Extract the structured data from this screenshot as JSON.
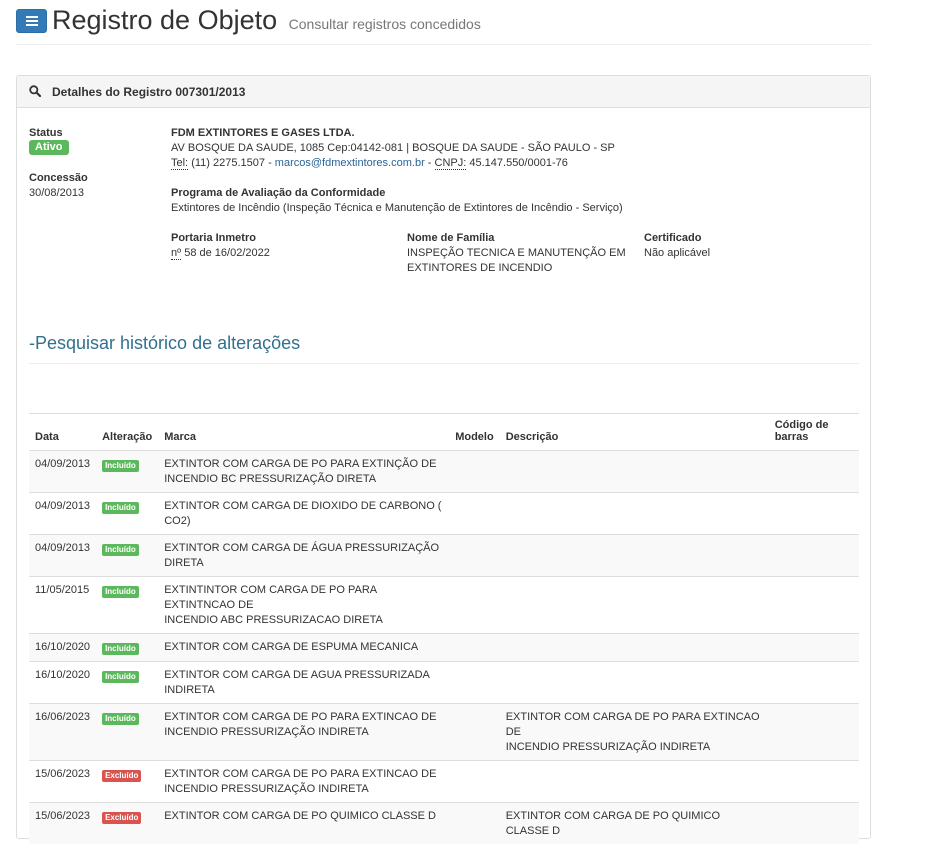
{
  "header": {
    "title": "Registro de Objeto",
    "subtitle": "Consultar registros concedidos"
  },
  "panel": {
    "title": "Detalhes do Registro 007301/2013"
  },
  "details": {
    "status_label": "Status",
    "status_value": "Ativo",
    "concessao_label": "Concessão",
    "concessao_value": "30/08/2013",
    "company_name": "FDM EXTINTORES E GASES LTDA.",
    "address": "AV BOSQUE DA SAUDE, 1085 Cep:04142-081 | BOSQUE DA SAUDE - SÃO PAULO - SP",
    "tel_label": "Tel:",
    "tel_value": "(11) 2275.1507",
    "separator": "-",
    "email": "marcos@fdmextintores.com.br",
    "cnpj_label": "CNPJ:",
    "cnpj_value": "45.147.550/0001-76",
    "programa_label": "Programa de Avaliação da Conformidade",
    "programa_value": "Extintores de Incêndio (Inspeção Técnica e Manutenção de Extintores de Incêndio - Serviço)",
    "portaria_label": "Portaria Inmetro",
    "portaria_abbr": "nº",
    "portaria_value": "58 de 16/02/2022",
    "familia_label": "Nome de Família",
    "familia_line1": "INSPEÇÃO TECNICA E MANUTENÇÃO EM",
    "familia_line2": "EXTINTORES DE INCENDIO",
    "certificado_label": "Certificado",
    "certificado_value": "Não aplicável"
  },
  "history": {
    "title": "-Pesquisar histórico de alterações",
    "columns": {
      "data": "Data",
      "alteracao": "Alteração",
      "marca": "Marca",
      "modelo": "Modelo",
      "descricao": "Descrição",
      "codigo_line1": "Código de",
      "codigo_line2": "barras"
    },
    "rows": [
      {
        "data": "04/09/2013",
        "alteracao": "Incluído",
        "marca1": "EXTINTOR COM CARGA DE PO PARA EXTINÇÃO DE",
        "marca2": "INCENDIO BC PRESSURIZAÇÃO DIRETA",
        "modelo": "",
        "desc1": "",
        "desc2": "",
        "codigo": ""
      },
      {
        "data": "04/09/2013",
        "alteracao": "Incluído",
        "marca1": "EXTINTOR COM CARGA DE DIOXIDO DE CARBONO (",
        "marca2": "CO2)",
        "modelo": "",
        "desc1": "",
        "desc2": "",
        "codigo": ""
      },
      {
        "data": "04/09/2013",
        "alteracao": "Incluído",
        "marca1": "EXTINTOR COM CARGA DE ÁGUA PRESSURIZAÇÃO",
        "marca2": "DIRETA",
        "modelo": "",
        "desc1": "",
        "desc2": "",
        "codigo": ""
      },
      {
        "data": "11/05/2015",
        "alteracao": "Incluído",
        "marca1": "EXTINTINTOR COM CARGA DE PO PARA EXTINTNCAO DE",
        "marca2": "INCENDIO ABC PRESSURIZACAO DIRETA",
        "modelo": "",
        "desc1": "",
        "desc2": "",
        "codigo": ""
      },
      {
        "data": "16/10/2020",
        "alteracao": "Incluído",
        "marca1": "EXTINTOR COM CARGA DE ESPUMA MECANICA",
        "marca2": "",
        "modelo": "",
        "desc1": "",
        "desc2": "",
        "codigo": ""
      },
      {
        "data": "16/10/2020",
        "alteracao": "Incluído",
        "marca1": "EXTINTOR COM CARGA DE AGUA PRESSURIZADA",
        "marca2": "INDIRETA",
        "modelo": "",
        "desc1": "",
        "desc2": "",
        "codigo": ""
      },
      {
        "data": "16/06/2023",
        "alteracao": "Incluído",
        "marca1": "EXTINTOR COM CARGA DE PO PARA EXTINCAO DE",
        "marca2": "INCENDIO PRESSURIZAÇÃO INDIRETA",
        "modelo": "",
        "desc1": "EXTINTOR COM CARGA DE PO PARA EXTINCAO DE",
        "desc2": "INCENDIO PRESSURIZAÇÃO INDIRETA",
        "codigo": ""
      },
      {
        "data": "15/06/2023",
        "alteracao": "Excluído",
        "marca1": "EXTINTOR COM CARGA DE PO PARA EXTINCAO DE",
        "marca2": "INCENDIO PRESSURIZAÇÃO INDIRETA",
        "modelo": "",
        "desc1": "",
        "desc2": "",
        "codigo": ""
      },
      {
        "data": "15/06/2023",
        "alteracao": "Excluído",
        "marca1": "EXTINTOR COM CARGA DE PO QUIMICO CLASSE D",
        "marca2": "",
        "modelo": "",
        "desc1": "EXTINTOR COM CARGA DE PO QUIMICO CLASSE D",
        "desc2": "",
        "codigo": ""
      }
    ]
  },
  "colors": {
    "primary": "#337ab7",
    "success": "#5cb85c",
    "danger": "#d9534f",
    "section_title": "#31708f"
  }
}
